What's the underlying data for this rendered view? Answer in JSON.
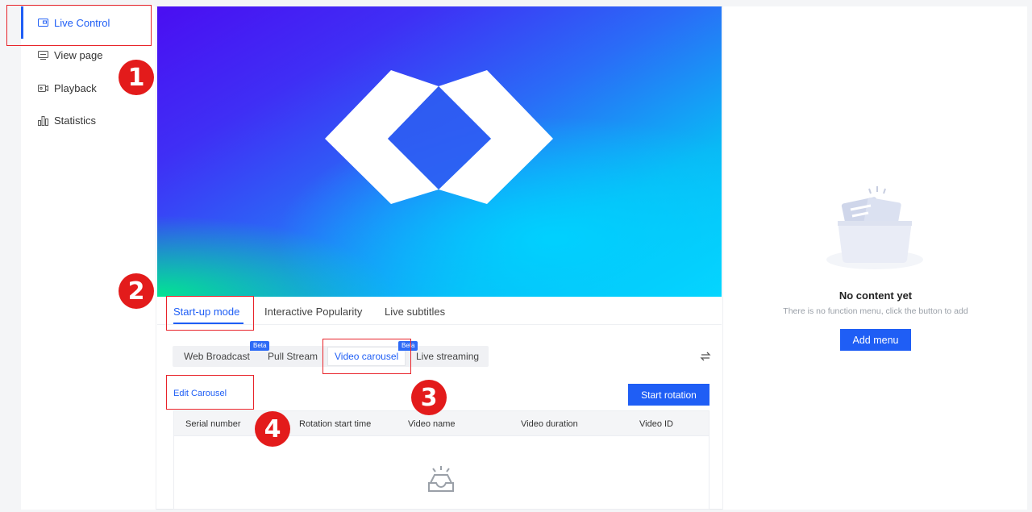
{
  "sidebar": {
    "items": [
      {
        "label": "Live Control",
        "icon": "live-control-icon",
        "active": true
      },
      {
        "label": "View page",
        "icon": "view-page-icon",
        "active": false
      },
      {
        "label": "Playback",
        "icon": "playback-icon",
        "active": false
      },
      {
        "label": "Statistics",
        "icon": "statistics-icon",
        "active": false
      }
    ]
  },
  "main": {
    "tabs": [
      {
        "label": "Start-up mode",
        "active": true
      },
      {
        "label": "Interactive Popularity",
        "active": false
      },
      {
        "label": "Live subtitles",
        "active": false
      }
    ],
    "modes": [
      {
        "label": "Web Broadcast",
        "beta": false
      },
      {
        "label": "Pull Stream",
        "beta": "Beta"
      },
      {
        "label": "Video carousel",
        "beta": false,
        "active": true
      },
      {
        "label": "Live streaming",
        "beta": "Beta"
      }
    ],
    "edit_carousel": "Edit Carousel",
    "start_rotation": "Start rotation",
    "table": {
      "columns": [
        "Serial number",
        "Rotation start time",
        "Video name",
        "Video duration",
        "Video ID"
      ]
    }
  },
  "right_panel": {
    "empty_title": "No content yet",
    "empty_subtitle": "There is no function menu, click the button to add",
    "add_menu": "Add menu"
  },
  "annotations": [
    "1",
    "2",
    "3",
    "4"
  ],
  "colors": {
    "accent": "#1f5ef5",
    "annotation": "#e31b1b"
  }
}
